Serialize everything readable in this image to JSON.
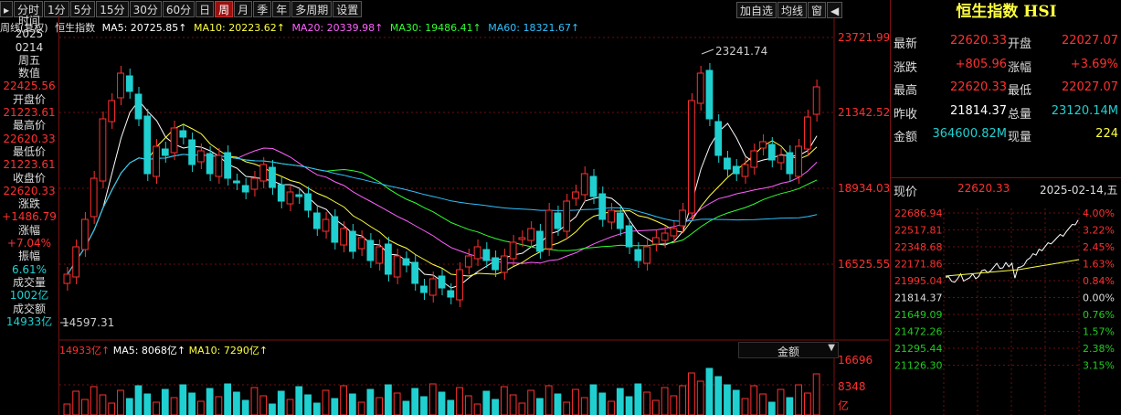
{
  "toolbar": {
    "periods": [
      "分时",
      "1分",
      "5分",
      "15分",
      "30分",
      "60分",
      "日",
      "周",
      "月",
      "季",
      "年",
      "多周期",
      "设置"
    ],
    "active": "周",
    "right_buttons": [
      "加自选",
      "均线",
      "窗"
    ]
  },
  "ma_line": {
    "label": "周线(复权)",
    "name": "恒生指数",
    "ma5": "MA5: 20725.85↑",
    "ma10": "MA10: 20223.62↑",
    "ma20": "MA20: 20339.98↑",
    "ma30": "MA30: 19486.41↑",
    "ma60": "MA60: 18321.67↑"
  },
  "left_panel": {
    "time_label": "时间",
    "year": "2025",
    "date": "0214",
    "weekday": "周五",
    "value_label": "数值",
    "value": "22425.56",
    "open_label": "开盘价",
    "open": "21223.61",
    "high_label": "最高价",
    "high": "22620.33",
    "low_label": "最低价",
    "low": "21223.61",
    "close_label": "收盘价",
    "close": "22620.33",
    "change_label": "涨跌",
    "change": "+1486.79",
    "pct_label": "涨幅",
    "pct": "+7.04%",
    "amp_label": "振幅",
    "amp": "6.61%",
    "vol_label": "成交量",
    "vol": "1002亿",
    "amt_label": "成交额",
    "amt": "14933亿"
  },
  "price_axis": [
    "23721.99",
    "21342.52",
    "18934.03",
    "16525.55"
  ],
  "annotations": {
    "high": "23241.74",
    "low": "14597.31"
  },
  "volume": {
    "header_amt": "14933亿↑",
    "ma5": "MA5: 8068亿↑",
    "ma10": "MA10: 7290亿↑",
    "selector": "金额",
    "axis": [
      "16696",
      "8348",
      "亿"
    ]
  },
  "right_panel": {
    "title": "恒生指数 HSI",
    "rows": [
      {
        "l1": "最新",
        "v1": "22620.33",
        "l2": "开盘",
        "v2": "22027.07"
      },
      {
        "l1": "涨跌",
        "v1": "+805.96",
        "l2": "涨幅",
        "v2": "+3.69%"
      },
      {
        "l1": "最高",
        "v1": "22620.33",
        "l2": "最低",
        "v2": "22027.07"
      },
      {
        "l1": "昨收",
        "v1": "21814.37",
        "l2": "总量",
        "v2": "23120.14M"
      },
      {
        "l1": "金额",
        "v1": "364600.82M",
        "l2": "现量",
        "v2": "224"
      }
    ],
    "now_label": "现价",
    "now_value": "22620.33",
    "now_date": "2025-02-14,五",
    "mini_left": [
      "22686.94",
      "22517.81",
      "22348.68",
      "22171.86",
      "21995.04",
      "21814.37",
      "21649.09",
      "21472.26",
      "21295.44",
      "21126.30"
    ],
    "mini_right": [
      "4.00%",
      "3.22%",
      "2.45%",
      "1.63%",
      "0.84%",
      "0.00%",
      "0.76%",
      "1.57%",
      "2.38%",
      "3.15%"
    ]
  },
  "colors": {
    "up": "#ff3030",
    "down": "#20d0d0",
    "ma5": "#ffffff",
    "ma10": "#ffff40",
    "ma20": "#ff60ff",
    "ma30": "#30ff30",
    "ma60": "#3090ff",
    "grid": "#6a1010"
  }
}
